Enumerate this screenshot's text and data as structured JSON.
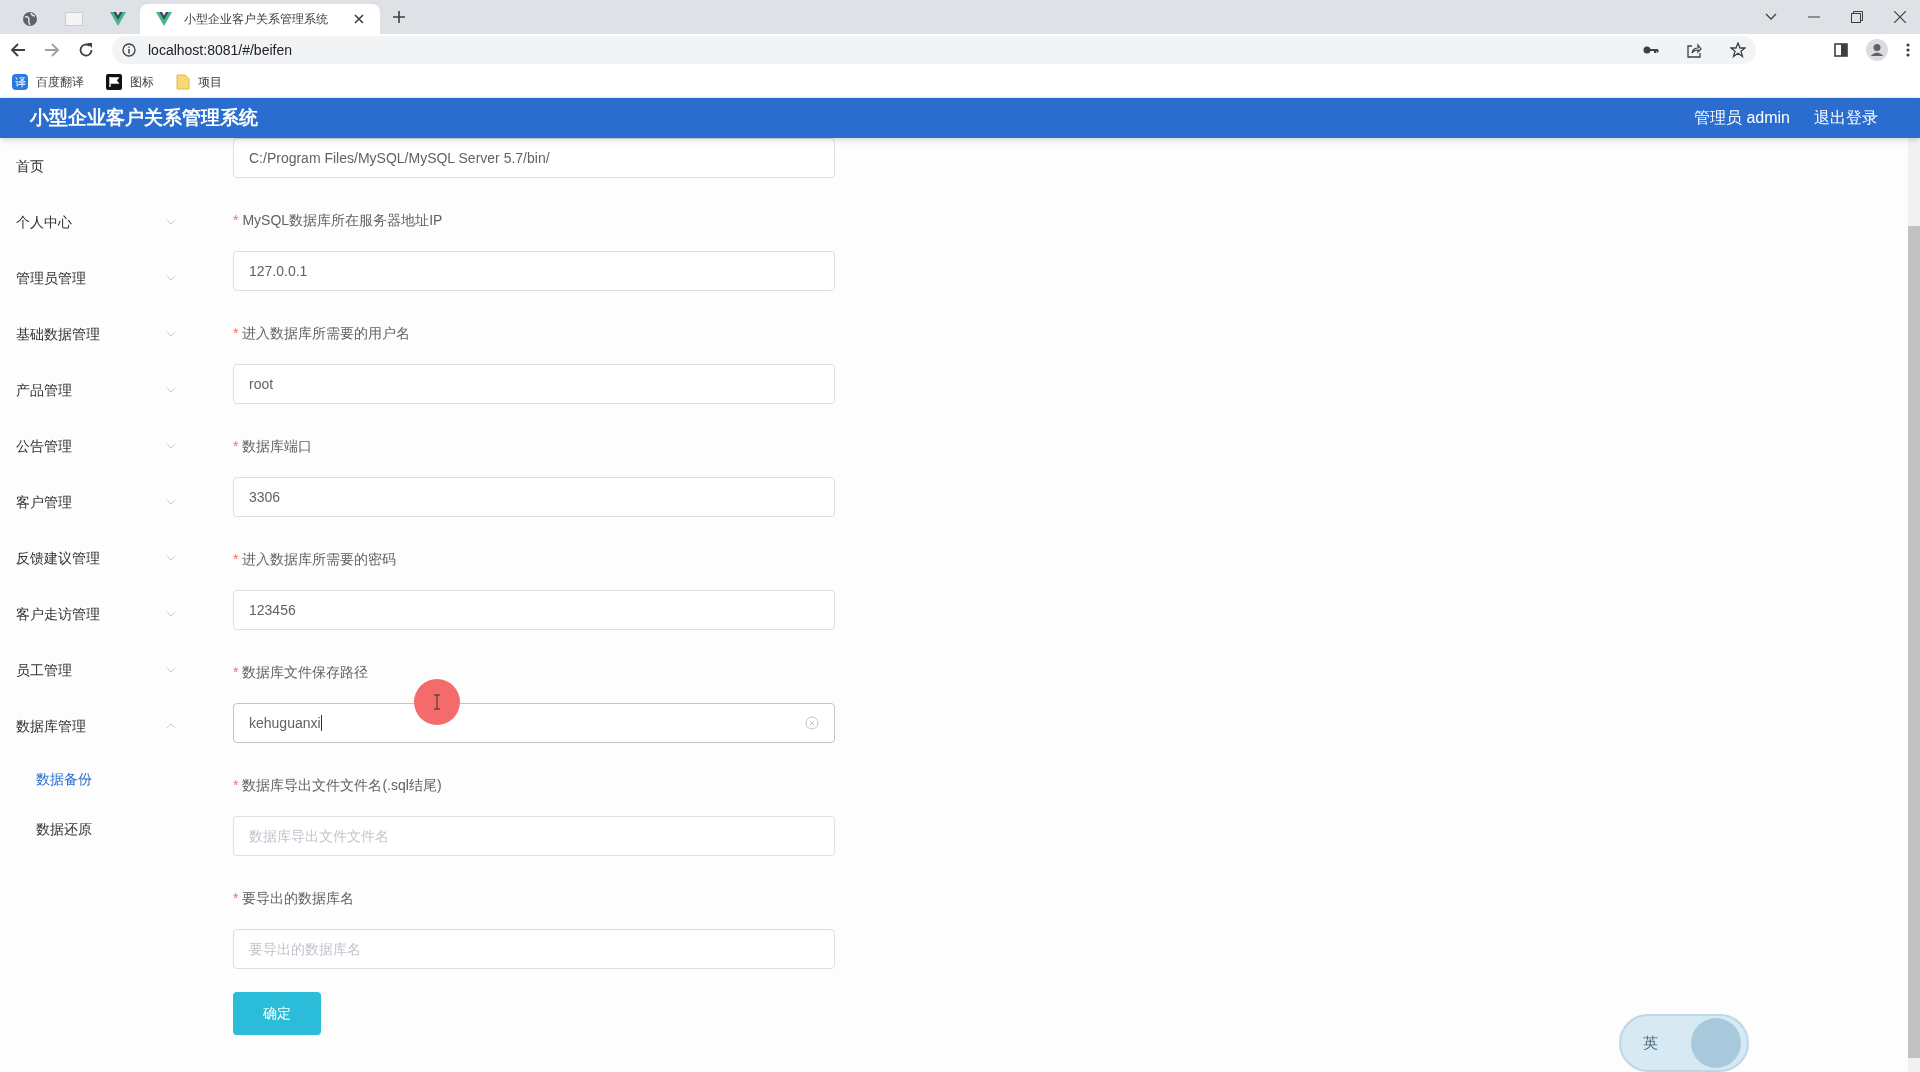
{
  "browser": {
    "tabs": [
      {
        "kind": "globe",
        "selected": false
      },
      {
        "kind": "blank",
        "selected": false
      },
      {
        "kind": "vue",
        "selected": false
      },
      {
        "kind": "vue",
        "title": "小型企业客户关系管理系统",
        "selected": true
      }
    ],
    "address": "localhost:8081/#/beifen",
    "bookmarks": [
      {
        "kind": "translate",
        "icon_text": "译",
        "label": "百度翻译"
      },
      {
        "kind": "flag",
        "label": "图标"
      },
      {
        "kind": "folder",
        "label": "项目"
      }
    ]
  },
  "header": {
    "title": "小型企业客户关系管理系统",
    "user": "管理员 admin",
    "logout": "退出登录"
  },
  "sidebar": {
    "items": [
      {
        "label": "首页",
        "selected": false
      },
      {
        "label": "个人中心",
        "expanded": false,
        "selected": false
      },
      {
        "label": "管理员管理",
        "expanded": false,
        "selected": false
      },
      {
        "label": "基础数据管理",
        "expanded": false,
        "selected": false
      },
      {
        "label": "产品管理",
        "expanded": false,
        "selected": false
      },
      {
        "label": "公告管理",
        "expanded": false,
        "selected": false
      },
      {
        "label": "客户管理",
        "expanded": false,
        "selected": false
      },
      {
        "label": "反馈建议管理",
        "expanded": false,
        "selected": false
      },
      {
        "label": "客户走访管理",
        "expanded": false,
        "selected": false
      },
      {
        "label": "员工管理",
        "expanded": false,
        "selected": false
      },
      {
        "label": "数据库管理",
        "expanded": true,
        "selected": false,
        "children": [
          {
            "label": "数据备份",
            "selected": true
          },
          {
            "label": "数据还原",
            "selected": false
          }
        ]
      }
    ]
  },
  "form": {
    "fields": [
      {
        "value": "C:/Program Files/MySQL/MySQL Server 5.7/bin/",
        "focused": false
      },
      {
        "label": "MySQL数据库所在服务器地址IP",
        "required_mark": "*",
        "value": "127.0.0.1",
        "focused": false
      },
      {
        "label": "进入数据库所需要的用户名",
        "required_mark": "*",
        "value": "root",
        "focused": false
      },
      {
        "label": "数据库端口",
        "required_mark": "*",
        "value": "3306",
        "focused": false
      },
      {
        "label": "进入数据库所需要的密码",
        "required_mark": "*",
        "value": "123456",
        "focused": false
      },
      {
        "label": "数据库文件保存路径",
        "required_mark": "*",
        "value": "kehuguanxi",
        "focused": true
      },
      {
        "label": "数据库导出文件文件名(.sql结尾)",
        "required_mark": "*",
        "placeholder": "数据库导出文件文件名",
        "focused": false
      },
      {
        "label": "要导出的数据库名",
        "required_mark": "*",
        "placeholder": "要导出的数据库名",
        "focused": false
      }
    ],
    "submit": "确定"
  },
  "ime": {
    "label": "英"
  }
}
